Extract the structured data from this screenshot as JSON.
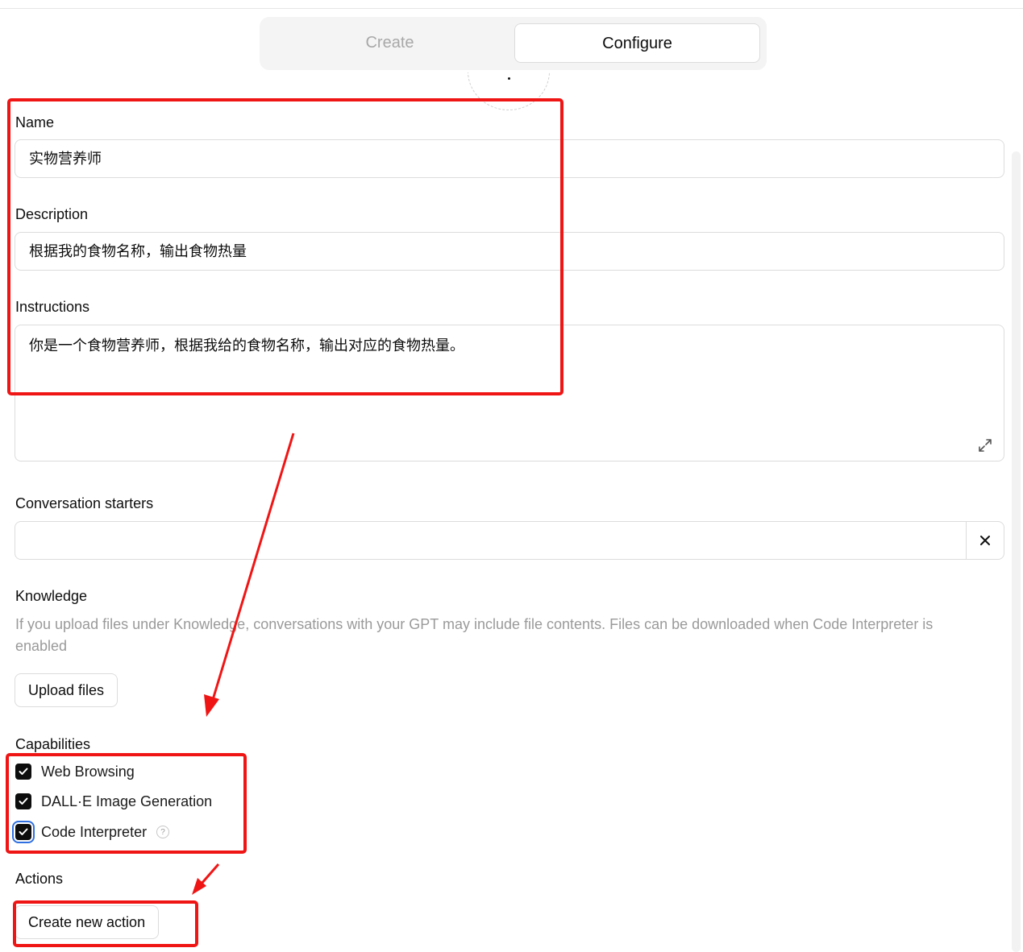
{
  "tabs": [
    {
      "label": "Create",
      "active": false
    },
    {
      "label": "Configure",
      "active": true
    }
  ],
  "name": {
    "label": "Name",
    "value": "实物营养师"
  },
  "description": {
    "label": "Description",
    "value": "根据我的食物名称，输出食物热量"
  },
  "instructions": {
    "label": "Instructions",
    "value": "你是一个食物营养师，根据我给的食物名称，输出对应的食物热量。"
  },
  "conversation_starters": {
    "label": "Conversation starters",
    "value": ""
  },
  "knowledge": {
    "label": "Knowledge",
    "description": "If you upload files under Knowledge, conversations with your GPT may include file contents. Files can be downloaded when Code Interpreter is enabled",
    "upload_label": "Upload files"
  },
  "capabilities": {
    "label": "Capabilities",
    "items": [
      {
        "label": "Web Browsing",
        "checked": true
      },
      {
        "label": "DALL·E Image Generation",
        "checked": true
      },
      {
        "label": "Code Interpreter",
        "checked": true,
        "help": "?"
      }
    ]
  },
  "actions": {
    "label": "Actions",
    "create_label": "Create new action"
  },
  "colors": {
    "annotation": "#f01515",
    "checkbox": "#0d0d0d",
    "focus_ring": "#2f6fe0"
  }
}
